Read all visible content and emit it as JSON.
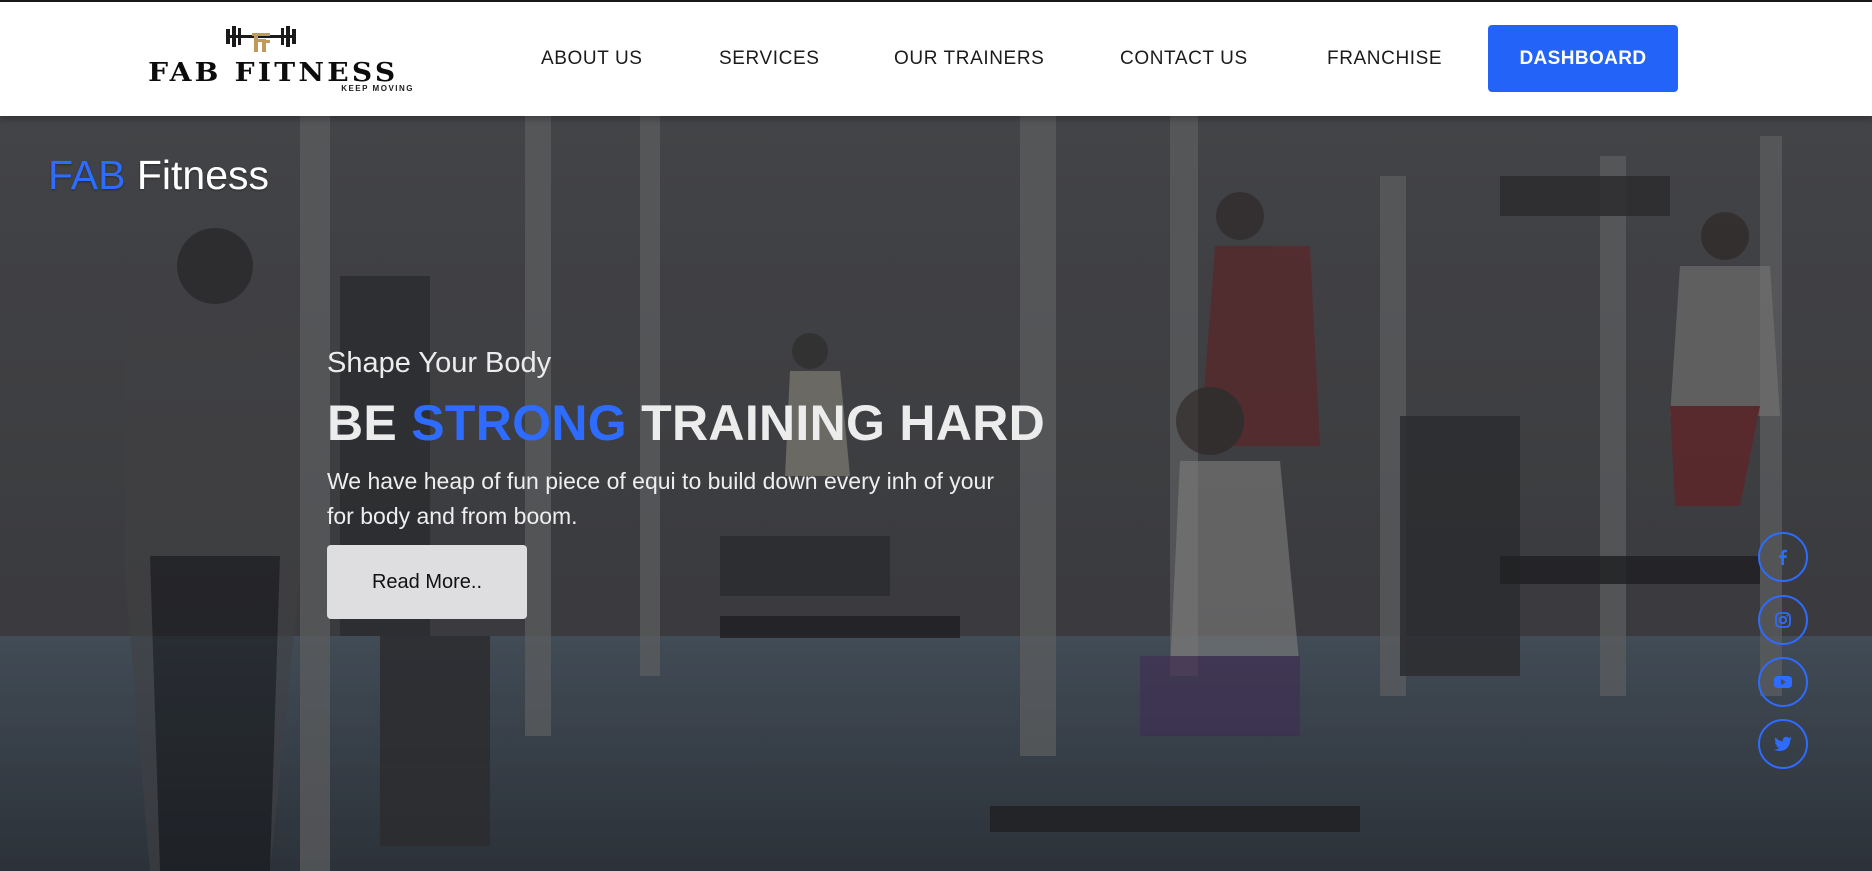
{
  "header": {
    "logo": {
      "name": "FAB FITNESS",
      "tagline": "KEEP MOVING"
    },
    "nav": [
      {
        "label": "ABOUT US"
      },
      {
        "label": "SERVICES"
      },
      {
        "label": "OUR TRAINERS"
      },
      {
        "label": "CONTACT US"
      },
      {
        "label": "FRANCHISE"
      }
    ],
    "dashboard_label": "DASHBOARD"
  },
  "hero": {
    "brand": {
      "first": "FAB",
      "second": "Fitness"
    },
    "subtitle": "Shape Your Body",
    "title": {
      "part1": "BE",
      "accent": "STRONG",
      "part2": "TRAINING HARD"
    },
    "description": "We have heap of fun piece of equi to build down every inh of your for body and from boom.",
    "read_more_label": "Read More.."
  },
  "social": [
    {
      "icon": "facebook-icon"
    },
    {
      "icon": "instagram-icon"
    },
    {
      "icon": "youtube-icon"
    },
    {
      "icon": "twitter-icon"
    }
  ],
  "colors": {
    "accent": "#2463f7",
    "brand_blue": "#2e6bff",
    "header_bg": "#ffffff",
    "logo_gold": "#c19a5b"
  }
}
